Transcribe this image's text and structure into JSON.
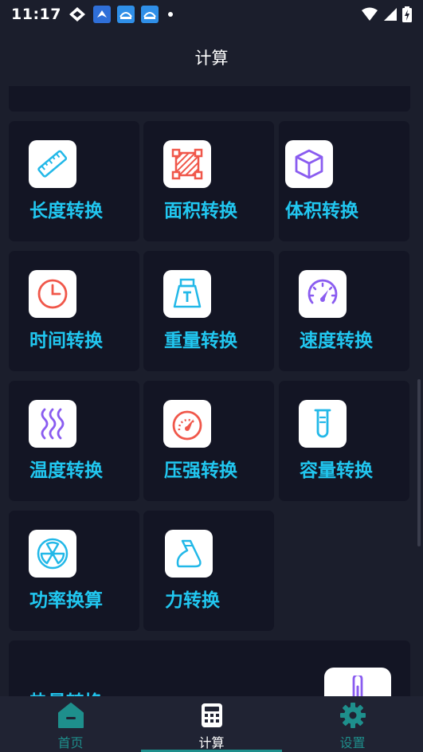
{
  "status_bar": {
    "time": "11:17",
    "notification_icons": [
      "diamond-icon",
      "bird-app-icon",
      "app-icon-1",
      "app-icon-2",
      "dot-icon"
    ],
    "system_icons": [
      "wifi-icon",
      "signal-icon",
      "battery-charging-icon"
    ]
  },
  "app_bar": {
    "title": "计算"
  },
  "tiles": [
    {
      "label": "长度转换",
      "icon": "ruler-icon"
    },
    {
      "label": "面积转换",
      "icon": "area-icon"
    },
    {
      "label": "体积转换",
      "icon": "cube-icon"
    },
    {
      "label": "时间转换",
      "icon": "clock-icon"
    },
    {
      "label": "重量转换",
      "icon": "weight-icon"
    },
    {
      "label": "速度转换",
      "icon": "speedometer-icon"
    },
    {
      "label": "温度转换",
      "icon": "heat-icon"
    },
    {
      "label": "压强转换",
      "icon": "gauge-icon"
    },
    {
      "label": "容量转换",
      "icon": "test-tube-icon"
    },
    {
      "label": "功率换算",
      "icon": "power-icon"
    },
    {
      "label": "力转换",
      "icon": "force-icon"
    }
  ],
  "partial_card": {
    "label": "热量转换",
    "icon": "thermometer-icon"
  },
  "nav": {
    "items": [
      {
        "label": "首页",
        "icon": "home-icon",
        "active": false
      },
      {
        "label": "计算",
        "icon": "calculator-icon",
        "active": true
      },
      {
        "label": "设置",
        "icon": "gear-icon",
        "active": false
      }
    ]
  },
  "colors": {
    "background": "#1b1e2c",
    "card": "#131524",
    "label": "#21c7f0",
    "nav_active": "#ffffff",
    "nav_inactive": "#1e8f8c"
  }
}
